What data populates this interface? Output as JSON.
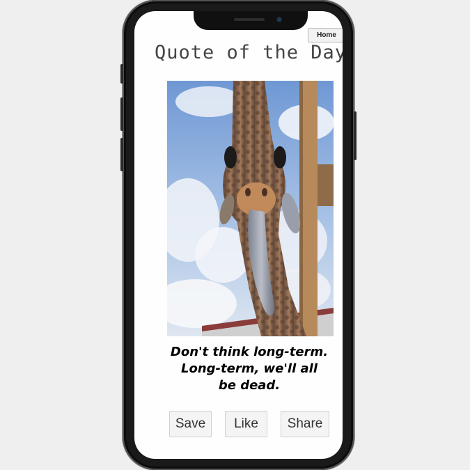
{
  "header": {
    "home_label": "Home",
    "title": "Quote of the Day"
  },
  "photo": {
    "subject": "giraffe sticking out tongue"
  },
  "quote": {
    "line1": "Don't think long-term.",
    "line2": "Long-term, we'll all",
    "line3": "be dead."
  },
  "actions": {
    "save_label": "Save",
    "like_label": "Like",
    "share_label": "Share"
  },
  "colors": {
    "background": "#efefef",
    "phone_frame": "#1a1a1a",
    "screen": "#fefefe"
  }
}
